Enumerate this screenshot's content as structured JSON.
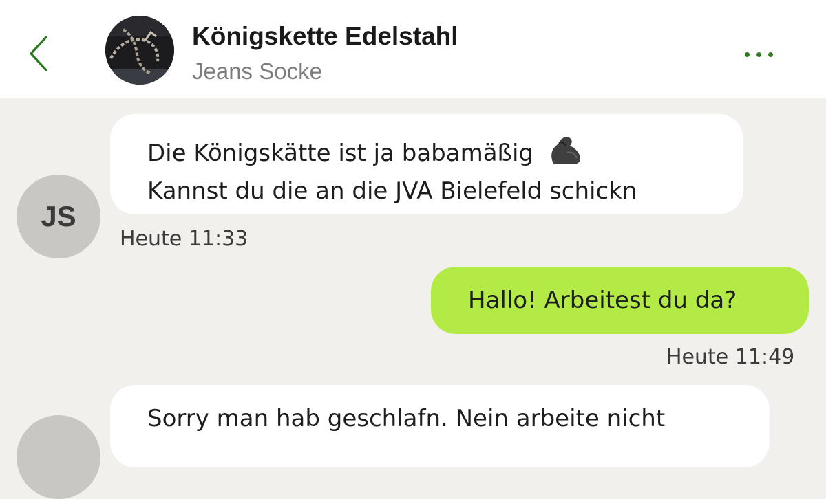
{
  "header": {
    "title": "Königskette Edelstahl",
    "subtitle": "Jeans Socke",
    "back_icon": "chevron-left-icon",
    "menu_icon": "more-horizontal-icon",
    "accent_color": "#2b7a1e"
  },
  "messages": [
    {
      "direction": "incoming",
      "avatar_initials": "JS",
      "lines": [
        "Die Königskätte ist ja babamäßig",
        "Kannst du die an die JVA Bielefeld schickn"
      ],
      "emoji": "flexed-biceps",
      "time": "Heute 11:33"
    },
    {
      "direction": "outgoing",
      "lines": [
        "Hallo! Arbeitest du da?"
      ],
      "time": "Heute 11:49"
    },
    {
      "direction": "incoming",
      "lines": [
        "Sorry man hab geschlafn. Nein arbeite nicht"
      ]
    }
  ],
  "colors": {
    "background": "#f1f0ed",
    "incoming_bubble": "#ffffff",
    "outgoing_bubble": "#b3ea46"
  }
}
